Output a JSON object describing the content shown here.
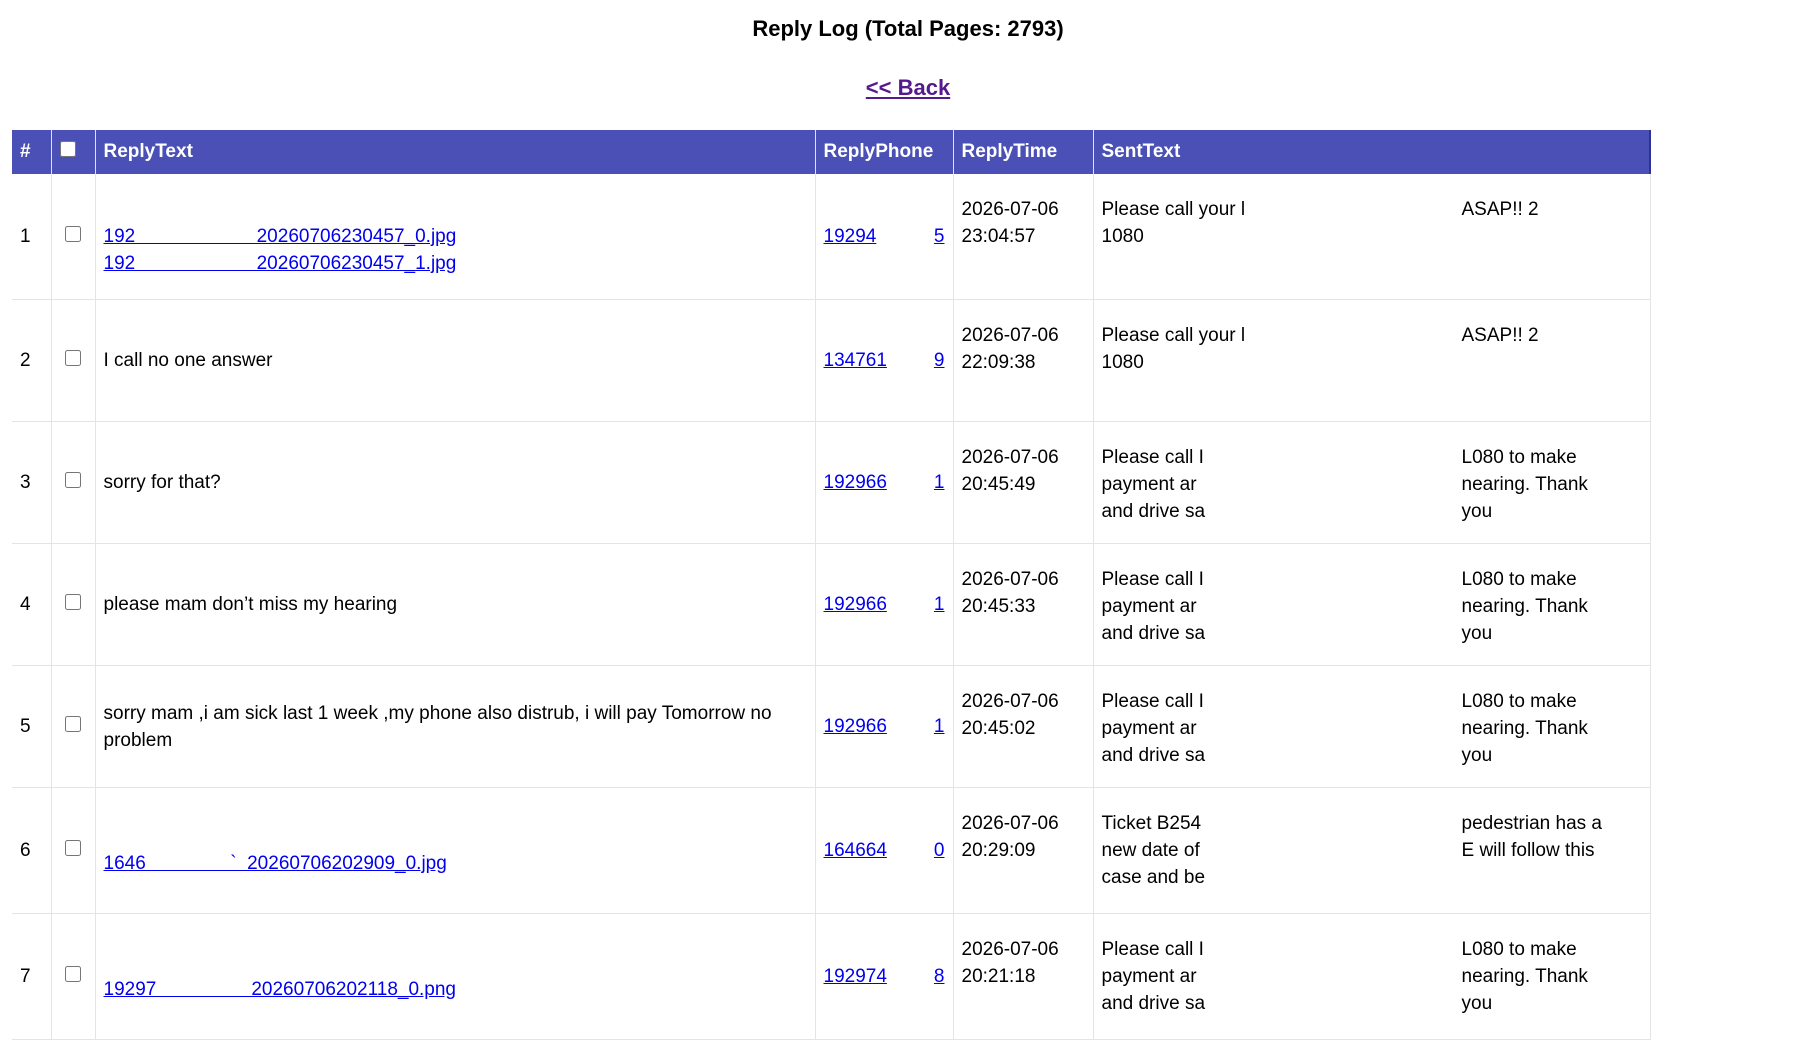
{
  "page": {
    "title": "Reply Log (Total Pages: 2793)",
    "back_label": "<< Back"
  },
  "table": {
    "headers": [
      "#",
      "",
      "ReplyText",
      "ReplyPhone",
      "ReplyTime",
      "SentText"
    ],
    "rows": [
      {
        "num": "1",
        "reply_lines": [
          "192                       20260706230457_0.jpg",
          "192                       20260706230457_1.jpg"
        ],
        "reply_is_link": true,
        "phone_a": "19294",
        "phone_b": "5",
        "time_date": "2026-07-06",
        "time_clock": "23:04:57",
        "sent_left": "Please call your l\n1080",
        "sent_right": "ASAP!! 2"
      },
      {
        "num": "2",
        "reply_lines": [
          "I call no one answer"
        ],
        "reply_is_link": false,
        "phone_a": "134761",
        "phone_b": "9",
        "time_date": "2026-07-06",
        "time_clock": "22:09:38",
        "sent_left": "Please call your l\n1080",
        "sent_right": "ASAP!! 2"
      },
      {
        "num": "3",
        "reply_lines": [
          "sorry for that?"
        ],
        "reply_is_link": false,
        "phone_a": "192966",
        "phone_b": "1",
        "time_date": "2026-07-06",
        "time_clock": "20:45:49",
        "sent_left": "Please call I\npayment ar\nand drive sa",
        "sent_right": "L080 to make\nnearing. Thank you"
      },
      {
        "num": "4",
        "reply_lines": [
          "please mam don’t miss my hearing"
        ],
        "reply_is_link": false,
        "phone_a": "192966",
        "phone_b": "1",
        "time_date": "2026-07-06",
        "time_clock": "20:45:33",
        "sent_left": "Please call I\npayment ar\nand drive sa",
        "sent_right": "L080 to make\nnearing. Thank you"
      },
      {
        "num": "5",
        "reply_lines": [
          "sorry mam ,i am sick last 1 week ,my phone also distrub, i will pay Tomorrow no problem"
        ],
        "reply_is_link": false,
        "phone_a": "192966",
        "phone_b": "1",
        "time_date": "2026-07-06",
        "time_clock": "20:45:02",
        "sent_left": "Please call I\npayment ar\nand drive sa",
        "sent_right": "L080 to make\nnearing. Thank you"
      },
      {
        "num": "6",
        "reply_lines": [
          "1646                `  20260706202909_0.jpg"
        ],
        "reply_is_link": true,
        "phone_a": "164664",
        "phone_b": "0",
        "time_date": "2026-07-06",
        "time_clock": "20:29:09",
        "sent_left": "Ticket B254\nnew date of\ncase and be",
        "sent_right": "pedestrian has a\nE will follow this"
      },
      {
        "num": "7",
        "reply_lines": [
          "19297                  20260706202118_0.png"
        ],
        "reply_is_link": true,
        "phone_a": "192974",
        "phone_b": "8",
        "time_date": "2026-07-06",
        "time_clock": "20:21:18",
        "sent_left": "Please call I\npayment ar\nand drive sa",
        "sent_right": "L080 to make\nnearing. Thank you"
      }
    ]
  },
  "colors": {
    "header_bg": "#4a50b5",
    "link": "#0000ee",
    "visited_link": "#551a8b"
  }
}
